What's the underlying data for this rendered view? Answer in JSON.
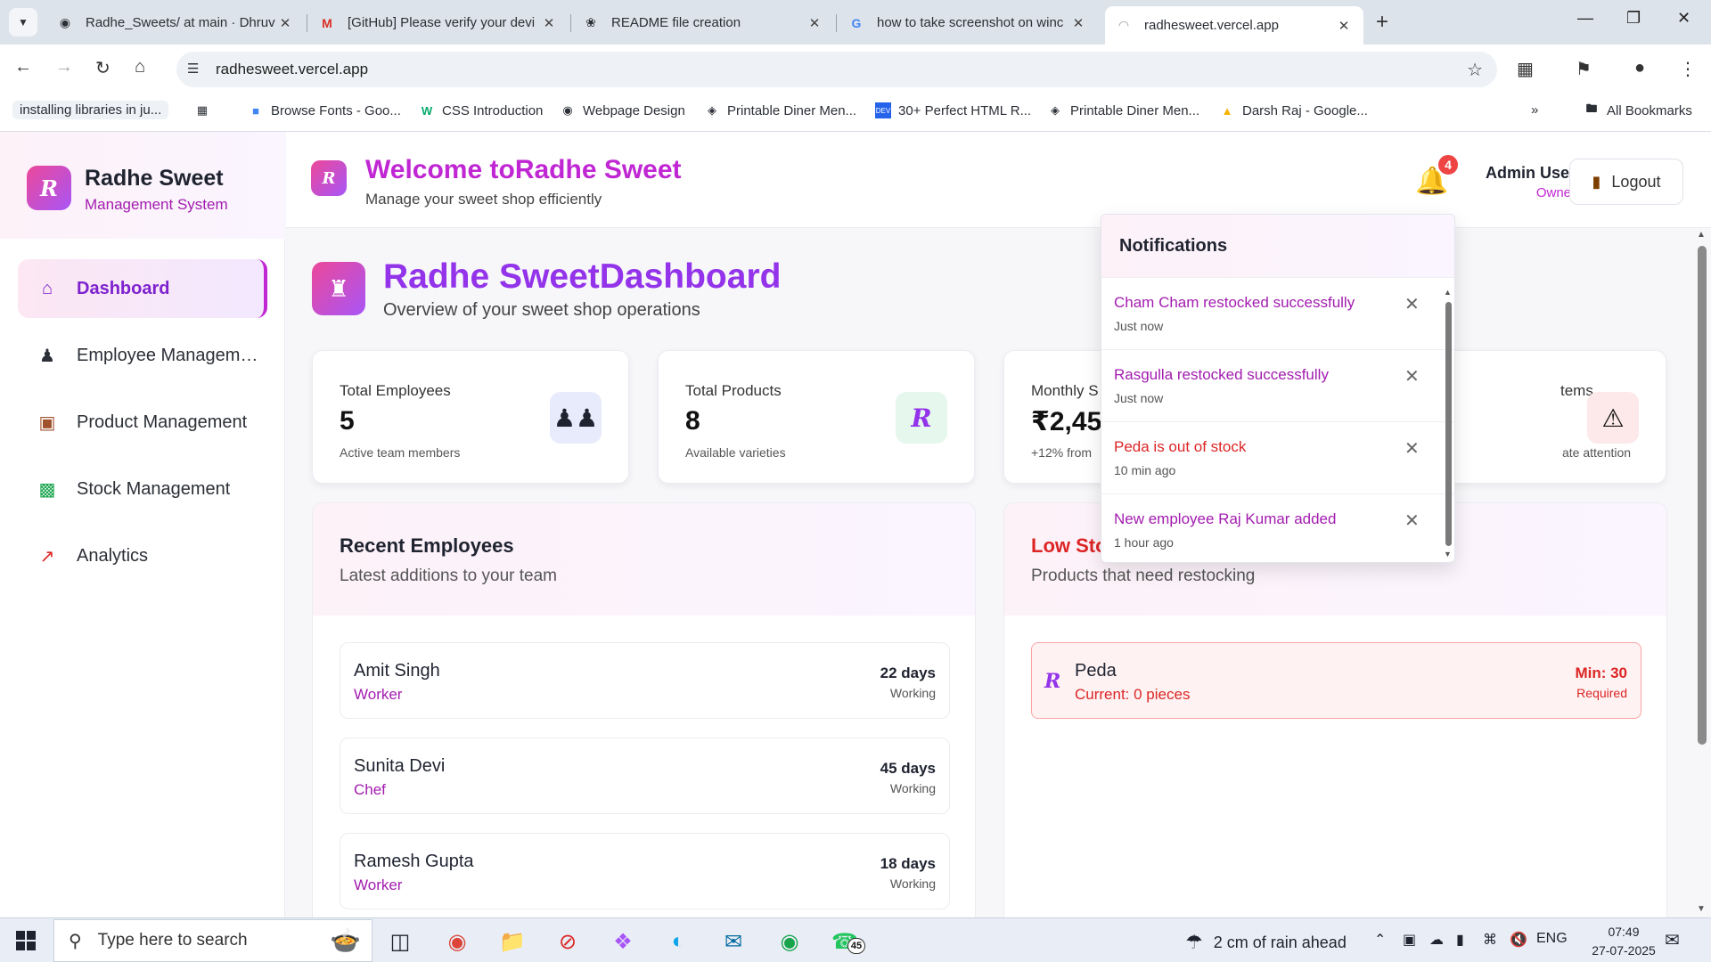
{
  "browser": {
    "tabs": [
      {
        "label": "Radhe_Sweets/ at main · Dhruv",
        "icon": "github-icon"
      },
      {
        "label": "[GitHub] Please verify your devi",
        "icon": "gmail-icon"
      },
      {
        "label": "README file creation",
        "icon": "chatgpt-icon"
      },
      {
        "label": "how to take screenshot on winc",
        "icon": "google-icon"
      },
      {
        "label": "radhesweet.vercel.app",
        "icon": "loading-icon"
      }
    ],
    "url": "radhesweet.vercel.app",
    "bookmarks": [
      {
        "label": "installing libraries in ju..."
      },
      {
        "label": "Browse Fonts - Goo..."
      },
      {
        "label": "CSS Introduction"
      },
      {
        "label": "Webpage Design"
      },
      {
        "label": "Printable Diner Men..."
      },
      {
        "label": "30+ Perfect HTML R..."
      },
      {
        "label": "Printable Diner Men..."
      },
      {
        "label": "Darsh Raj - Google..."
      }
    ],
    "all_bookmarks": "All Bookmarks"
  },
  "sidebar": {
    "logo_letter": "R",
    "title": "Radhe Sweet",
    "subtitle": "Management System",
    "items": [
      {
        "label": "Dashboard",
        "icon": "home-icon"
      },
      {
        "label": "Employee Management",
        "icon": "users-icon"
      },
      {
        "label": "Product Management",
        "icon": "package-icon"
      },
      {
        "label": "Stock Management",
        "icon": "bar-chart-icon"
      },
      {
        "label": "Analytics",
        "icon": "line-chart-icon"
      }
    ]
  },
  "header": {
    "logo_letter": "R",
    "title": "Welcome toRadhe Sweet",
    "subtitle": "Manage your sweet shop efficiently",
    "notification_count": "4",
    "user_name": "Admin User",
    "user_role": "Owner",
    "logout_label": "Logout"
  },
  "dashboard": {
    "title": "Radhe SweetDashboard",
    "subtitle": "Overview of your sweet shop operations",
    "stats": [
      {
        "label": "Total Employees",
        "value": "5",
        "note": "Active team members",
        "icon": "users-icon"
      },
      {
        "label": "Total Products",
        "value": "8",
        "note": "Available varieties",
        "icon": "r-logo-icon"
      },
      {
        "label": "Monthly S",
        "value": "₹2,45",
        "note": "+12% from",
        "icon": "revenue-icon"
      },
      {
        "label": "tems",
        "value": "",
        "note": "ate attention",
        "icon": "warning-icon"
      }
    ],
    "recent_employees": {
      "title": "Recent Employees",
      "subtitle": "Latest additions to your team",
      "rows": [
        {
          "name": "Amit Singh",
          "role": "Worker",
          "days": "22 days",
          "status": "Working"
        },
        {
          "name": "Sunita Devi",
          "role": "Chef",
          "days": "45 days",
          "status": "Working"
        },
        {
          "name": "Ramesh Gupta",
          "role": "Worker",
          "days": "18 days",
          "status": "Working"
        }
      ]
    },
    "low_stock": {
      "title": "Low Sto",
      "subtitle": "Products that need restocking",
      "items": [
        {
          "name": "Peda",
          "current": "Current: 0 pieces",
          "min": "Min: 30",
          "required": "Required"
        }
      ]
    }
  },
  "notifications": {
    "title": "Notifications",
    "items": [
      {
        "text": "Cham Cham restocked successfully",
        "time": "Just now",
        "color": "#a21caf"
      },
      {
        "text": "Rasgulla restocked successfully",
        "time": "Just now",
        "color": "#a21caf"
      },
      {
        "text": "Peda is out of stock",
        "time": "10 min ago",
        "color": "#dc2626"
      },
      {
        "text": "New employee Raj Kumar added",
        "time": "1 hour ago",
        "color": "#a21caf"
      }
    ]
  },
  "taskbar": {
    "search_placeholder": "Type here to search",
    "whatsapp_badge": "45",
    "weather": "2 cm of rain ahead",
    "language": "ENG",
    "time": "07:49",
    "date": "27-07-2025"
  }
}
